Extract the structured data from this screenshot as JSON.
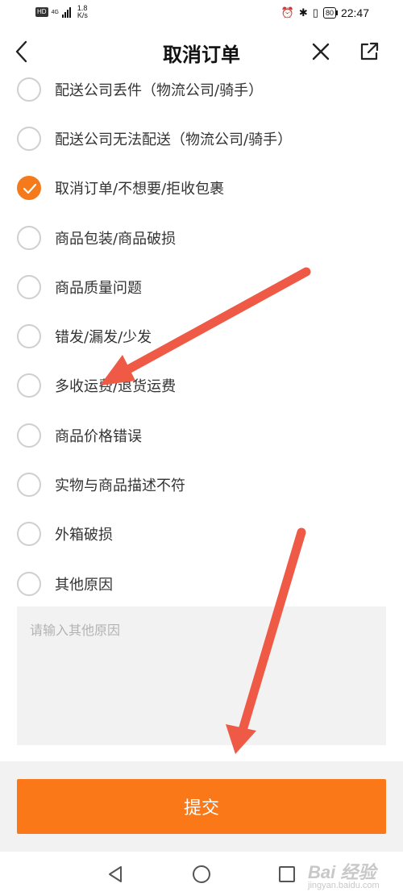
{
  "status_bar": {
    "hd": "HD",
    "network": "4G",
    "speed_value": "1.8",
    "speed_unit": "K/s",
    "battery": "80",
    "time": "22:47"
  },
  "header": {
    "title": "取消订单"
  },
  "reasons": [
    {
      "label": "配送公司丢件（物流公司/骑手）",
      "checked": false
    },
    {
      "label": "配送公司无法配送（物流公司/骑手）",
      "checked": false
    },
    {
      "label": "取消订单/不想要/拒收包裹",
      "checked": true
    },
    {
      "label": "商品包装/商品破损",
      "checked": false
    },
    {
      "label": "商品质量问题",
      "checked": false
    },
    {
      "label": "错发/漏发/少发",
      "checked": false
    },
    {
      "label": "多收运费/退货运费",
      "checked": false
    },
    {
      "label": "商品价格错误",
      "checked": false
    },
    {
      "label": "实物与商品描述不符",
      "checked": false
    },
    {
      "label": "外箱破损",
      "checked": false
    },
    {
      "label": "其他原因",
      "checked": false
    }
  ],
  "other_reason": {
    "placeholder": "请输入其他原因",
    "value": ""
  },
  "submit": {
    "label": "提交"
  },
  "watermark": {
    "text": "Bai 经验",
    "sub": "jingyan.baidu.com"
  },
  "colors": {
    "accent": "#fa7818",
    "checked": "#f57a1c",
    "annotation_arrow": "#ee5a45"
  }
}
